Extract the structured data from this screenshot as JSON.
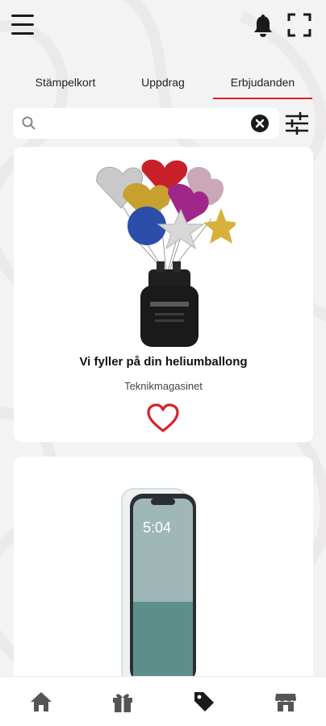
{
  "header": {
    "menu_icon": "hamburger-menu-icon",
    "notifications_icon": "bell-icon",
    "scan_icon": "scan-frame-icon"
  },
  "tabs": [
    {
      "label": "Stämpelkort",
      "active": false
    },
    {
      "label": "Uppdrag",
      "active": false
    },
    {
      "label": "Erbjudanden",
      "active": true
    }
  ],
  "search": {
    "value": "",
    "placeholder": "",
    "search_icon": "search-icon",
    "clear_icon": "clear-circle-icon",
    "filter_icon": "filter-sliders-icon"
  },
  "offers": [
    {
      "title": "Vi fyller på din heliumballong",
      "store": "Teknikmagasinet",
      "favorite_icon": "heart-outline-icon",
      "image": "helium-balloons-image"
    },
    {
      "title": "",
      "store": "",
      "image": "phone-screen-protector-image"
    }
  ],
  "bottom_nav": [
    {
      "name": "home",
      "icon": "home-icon",
      "active": false
    },
    {
      "name": "gifts",
      "icon": "gift-icon",
      "active": false
    },
    {
      "name": "offers",
      "icon": "tag-icon",
      "active": true
    },
    {
      "name": "stores",
      "icon": "store-icon",
      "active": false
    }
  ],
  "colors": {
    "accent": "#d9222a",
    "background": "#f4f3f3",
    "card": "#ffffff",
    "text": "#1a1a1a"
  }
}
